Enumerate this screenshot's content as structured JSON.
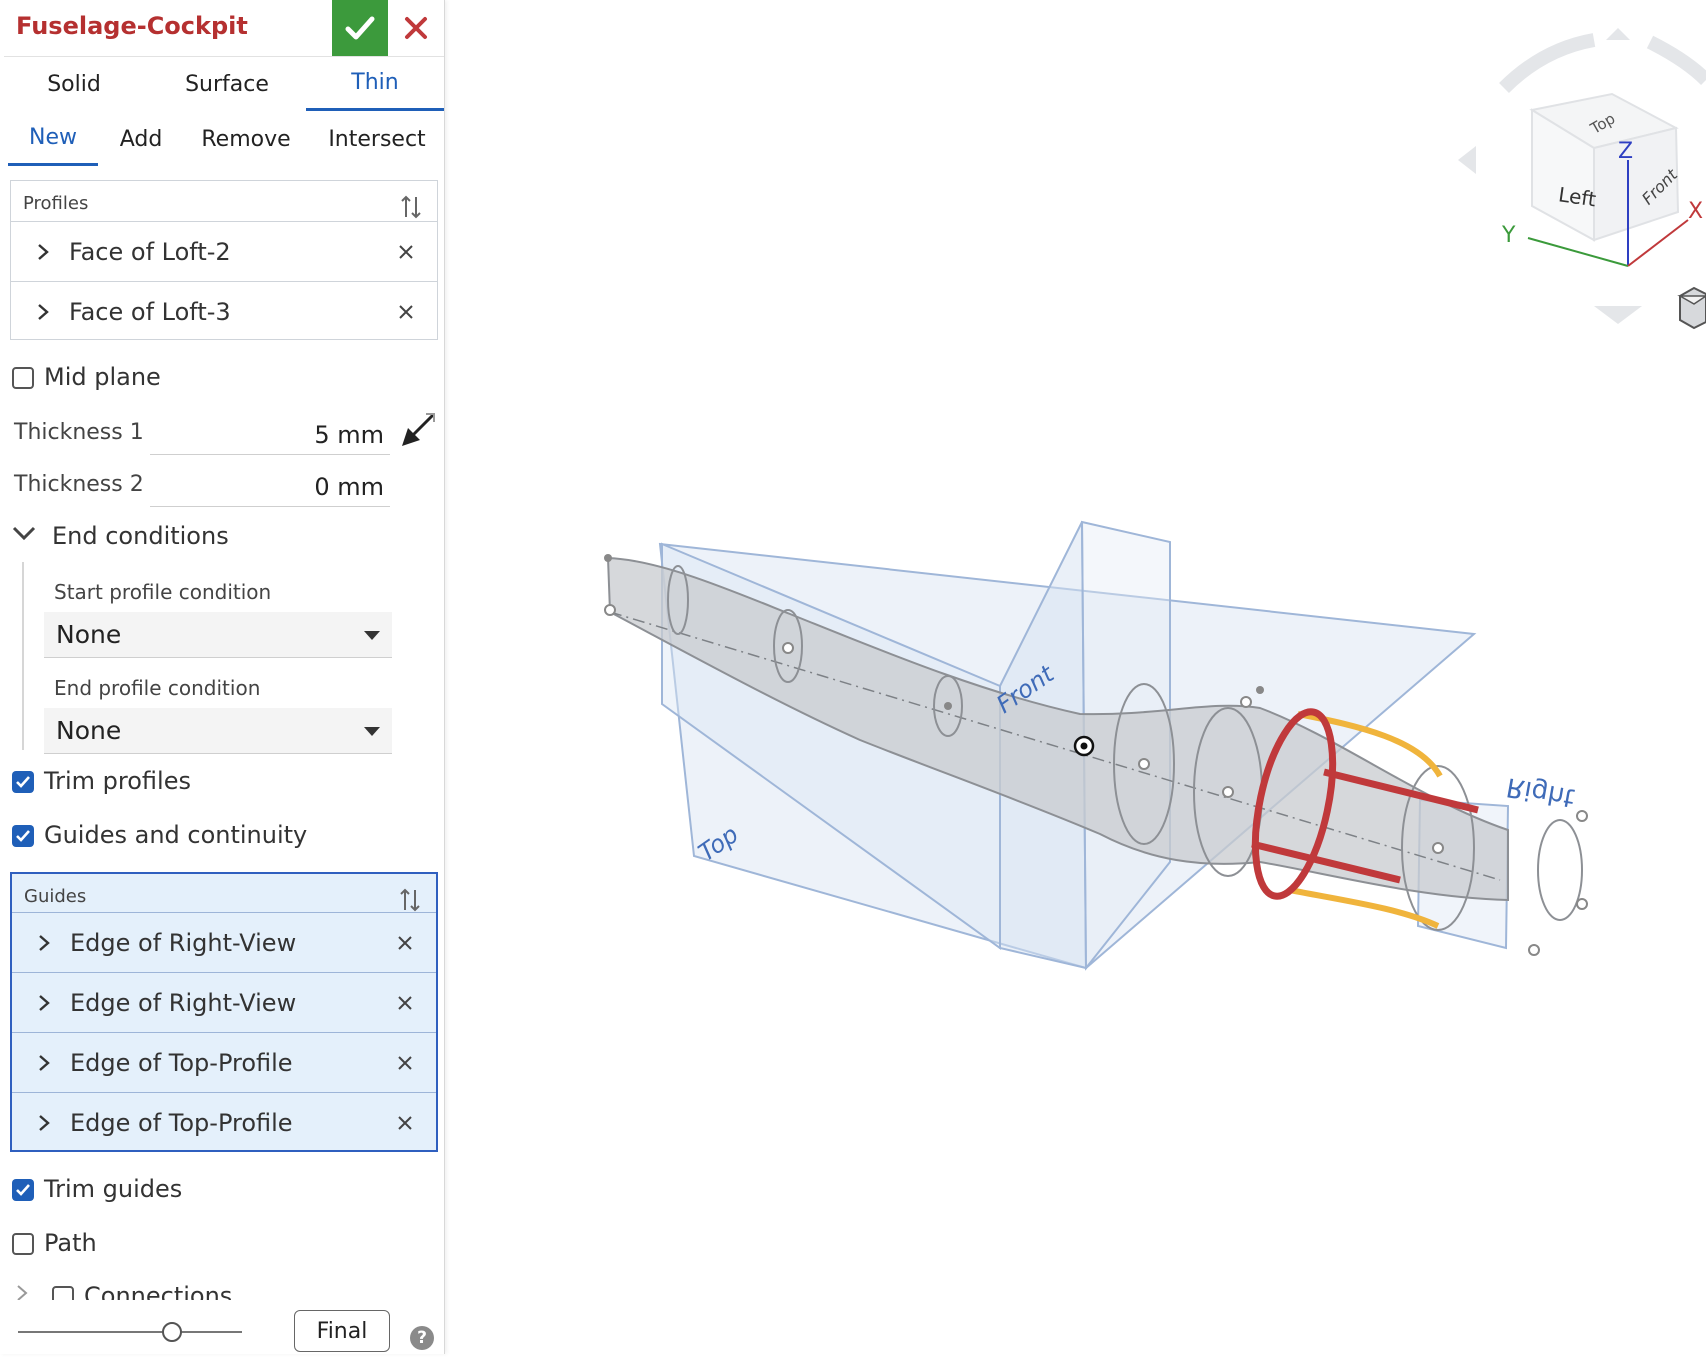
{
  "feature": {
    "title": "Fuselage-Cockpit"
  },
  "creation_types": [
    "Solid",
    "Surface",
    "Thin"
  ],
  "creation_active": "Thin",
  "operations": [
    "New",
    "Add",
    "Remove",
    "Intersect"
  ],
  "operation_active": "New",
  "profiles": {
    "label": "Profiles",
    "items": [
      "Face of Loft-2",
      "Face of Loft-3"
    ]
  },
  "mid_plane": {
    "label": "Mid plane",
    "checked": false
  },
  "thickness1": {
    "label": "Thickness 1",
    "value": "5 mm"
  },
  "thickness2": {
    "label": "Thickness 2",
    "value": "0 mm"
  },
  "end_conditions": {
    "label": "End conditions",
    "start_label": "Start profile condition",
    "start_value": "None",
    "end_label": "End profile condition",
    "end_value": "None"
  },
  "trim_profiles": {
    "label": "Trim profiles",
    "checked": true
  },
  "guides_continuity": {
    "label": "Guides and continuity",
    "checked": true
  },
  "guides": {
    "label": "Guides",
    "items": [
      "Edge of Right-View",
      "Edge of Right-View",
      "Edge of Top-Profile",
      "Edge of Top-Profile"
    ]
  },
  "trim_guides": {
    "label": "Trim guides",
    "checked": true
  },
  "path": {
    "label": "Path",
    "checked": false
  },
  "connections": {
    "label": "Connections",
    "checked": false
  },
  "final_button": "Final",
  "help_glyph": "?",
  "viewport": {
    "plane_labels": {
      "front": "Front",
      "top": "Top",
      "right": "Right"
    },
    "view_cube": {
      "top": "Top",
      "left": "Left",
      "front": "Front"
    },
    "axes": {
      "x": "X",
      "y": "Y",
      "z": "Z"
    },
    "colors": {
      "plane": "#9fb6d8",
      "body": "#c8cbcf",
      "highlight_red": "#c0393b",
      "highlight_orange": "#f0b43c",
      "accept_green": "#3c9a3c",
      "accent_blue": "#1f5fb8"
    }
  }
}
